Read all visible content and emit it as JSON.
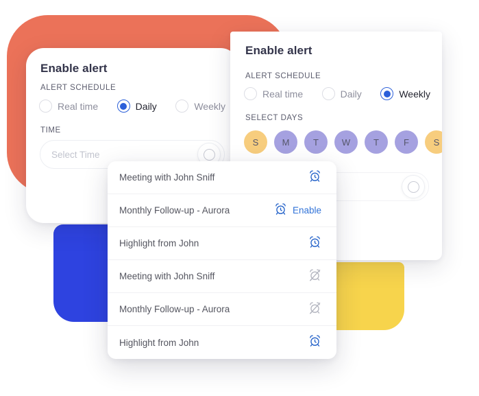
{
  "theme": {
    "accent_blue": "#2b5fd9",
    "link_blue": "#3173d8",
    "coral": "#eb7259",
    "royal_blue": "#2e43e0",
    "yellow": "#f7d44c",
    "weekend_pill": "#f7cd7e",
    "weekday_pill": "#a5a1e0",
    "title_color": "#33344a"
  },
  "card_daily": {
    "title": "Enable alert",
    "schedule_label": "ALERT SCHEDULE",
    "options": [
      {
        "label": "Real time",
        "selected": false
      },
      {
        "label": "Daily",
        "selected": true
      },
      {
        "label": "Weekly",
        "selected": false
      }
    ],
    "time_label": "TIME",
    "time_placeholder": "Select Time",
    "time_value": "",
    "clock_knob_icon": "clock-knob-icon"
  },
  "card_weekly": {
    "title": "Enable alert",
    "schedule_label": "ALERT SCHEDULE",
    "options": [
      {
        "label": "Real time",
        "selected": false
      },
      {
        "label": "Daily",
        "selected": false
      },
      {
        "label": "Weekly",
        "selected": true
      }
    ],
    "select_days_label": "SELECT DAYS",
    "days": [
      {
        "label": "S",
        "kind": "weekend"
      },
      {
        "label": "M",
        "kind": "weekday"
      },
      {
        "label": "T",
        "kind": "weekday"
      },
      {
        "label": "W",
        "kind": "weekday"
      },
      {
        "label": "T",
        "kind": "weekday"
      },
      {
        "label": "F",
        "kind": "weekday"
      },
      {
        "label": "S",
        "kind": "weekend"
      }
    ],
    "time_placeholder": "",
    "clock_knob_icon": "clock-knob-icon"
  },
  "list_panel": {
    "rows": [
      {
        "title": "Meeting with John Sniff",
        "icon": "alarm-clock-icon",
        "icon_state": "active",
        "action_label": ""
      },
      {
        "title": "Monthly Follow-up - Aurora",
        "icon": "alarm-clock-icon",
        "icon_state": "active",
        "action_label": "Enable"
      },
      {
        "title": "Highlight from John",
        "icon": "alarm-clock-icon",
        "icon_state": "active",
        "action_label": ""
      },
      {
        "title": "Meeting with John Sniff",
        "icon": "alarm-clock-off-icon",
        "icon_state": "disabled",
        "action_label": ""
      },
      {
        "title": "Monthly Follow-up - Aurora",
        "icon": "alarm-clock-off-icon",
        "icon_state": "disabled",
        "action_label": ""
      },
      {
        "title": "Highlight from John",
        "icon": "alarm-clock-icon",
        "icon_state": "active",
        "action_label": ""
      }
    ]
  }
}
